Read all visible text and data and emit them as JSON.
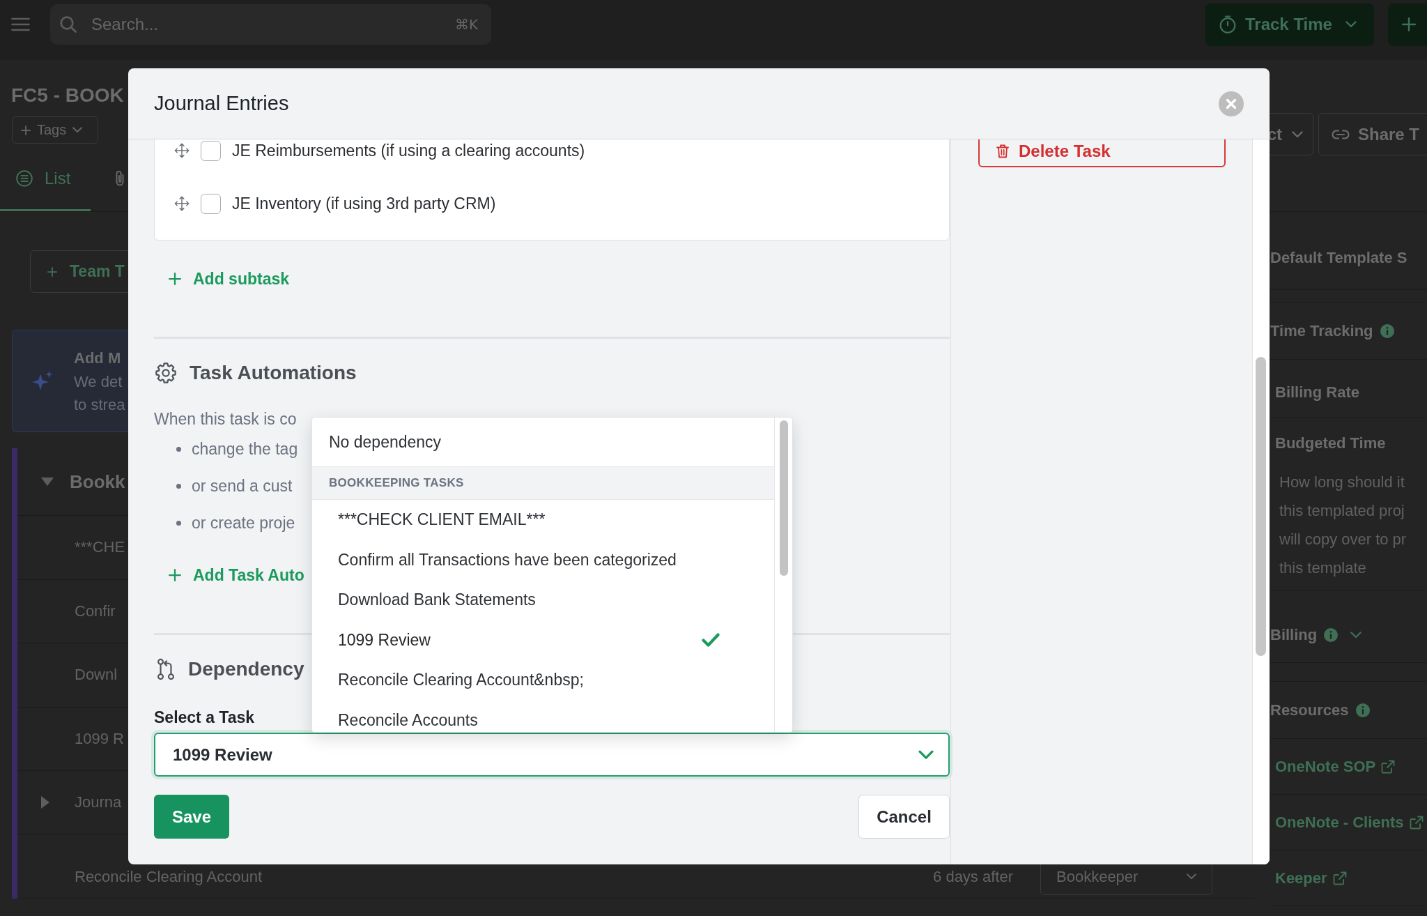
{
  "top_bar": {
    "search": {
      "placeholder": "Search...",
      "shortcut": "⌘K"
    },
    "track_time_button": "Track Time"
  },
  "page": {
    "title": "FC5 - BOOK",
    "tags_button": "Tags",
    "header_buttons": [
      {
        "kind": "dropdown",
        "label": "ct"
      },
      {
        "kind": "share",
        "label": "Share T"
      }
    ],
    "tabs": [
      {
        "label": "List",
        "selected": true
      },
      {
        "selected": false
      }
    ],
    "team_button": "Team T",
    "notice": {
      "title": "Add M",
      "text": "We det\nto strea"
    },
    "task_group": {
      "title": "Bookk",
      "expanded": true,
      "tasks": [
        {
          "kind": "task",
          "name": "***CHE"
        },
        {
          "kind": "task",
          "name": "Confir"
        },
        {
          "kind": "task",
          "name": "Downl"
        },
        {
          "kind": "task",
          "name": "1099 R"
        },
        {
          "kind": "parent",
          "name": "Journa",
          "expanded": false
        },
        {
          "kind": "scheduled",
          "name": "Reconcile Clearing Account",
          "timing": "6 days after",
          "assignee": "Bookkeeper"
        }
      ]
    }
  },
  "side_panel": {
    "sections": [
      {
        "kind": "heading",
        "title": "Default Template S"
      },
      {
        "kind": "info",
        "title": "Time Tracking"
      },
      {
        "kind": "field",
        "title": "Billing Rate"
      },
      {
        "kind": "field",
        "title": "Budgeted Time",
        "help": "How long should it\nthis templated proj\nwill copy over to pr\nthis template"
      },
      {
        "kind": "collapsible",
        "title": "Billing",
        "expanded": false
      },
      {
        "kind": "info",
        "title": "Resources"
      },
      {
        "kind": "link",
        "title": "OneNote SOP"
      },
      {
        "kind": "link",
        "title": "OneNote - Clients"
      },
      {
        "kind": "link",
        "title": "Keeper"
      }
    ]
  },
  "modal": {
    "title": "Journal Entries",
    "delete_button": "Delete Task",
    "subtasks": [
      {
        "label": "JE Reimbursements (if using a clearing accounts)",
        "checked": false
      },
      {
        "label": "JE Inventory (if using 3rd party CRM)",
        "checked": false
      }
    ],
    "add_subtask": "Add subtask",
    "automations": {
      "title": "Task Automations",
      "intro": "When this task is co",
      "actions": [
        "change the tag",
        "or send a cust",
        "or create proje"
      ],
      "add_button": "Add Task Auto"
    },
    "dependency": {
      "title": "Dependency",
      "field_label": "Select a Task",
      "value": "1099 Review",
      "menu": [
        {
          "kind": "option",
          "label": "No dependency",
          "selected": false
        },
        {
          "kind": "group",
          "title": "BOOKKEEPING TASKS",
          "options": [
            {
              "label": "***CHECK CLIENT EMAIL***",
              "selected": false
            },
            {
              "label": "Confirm all Transactions have been categorized",
              "selected": false
            },
            {
              "label": "Download Bank Statements",
              "selected": false
            },
            {
              "label": "1099 Review",
              "selected": true
            },
            {
              "label": "Reconcile Clearing Account&nbsp;",
              "selected": false
            },
            {
              "label": "Reconcile Accounts",
              "selected": false
            }
          ]
        }
      ]
    },
    "save_button": "Save",
    "cancel_button": "Cancel"
  }
}
